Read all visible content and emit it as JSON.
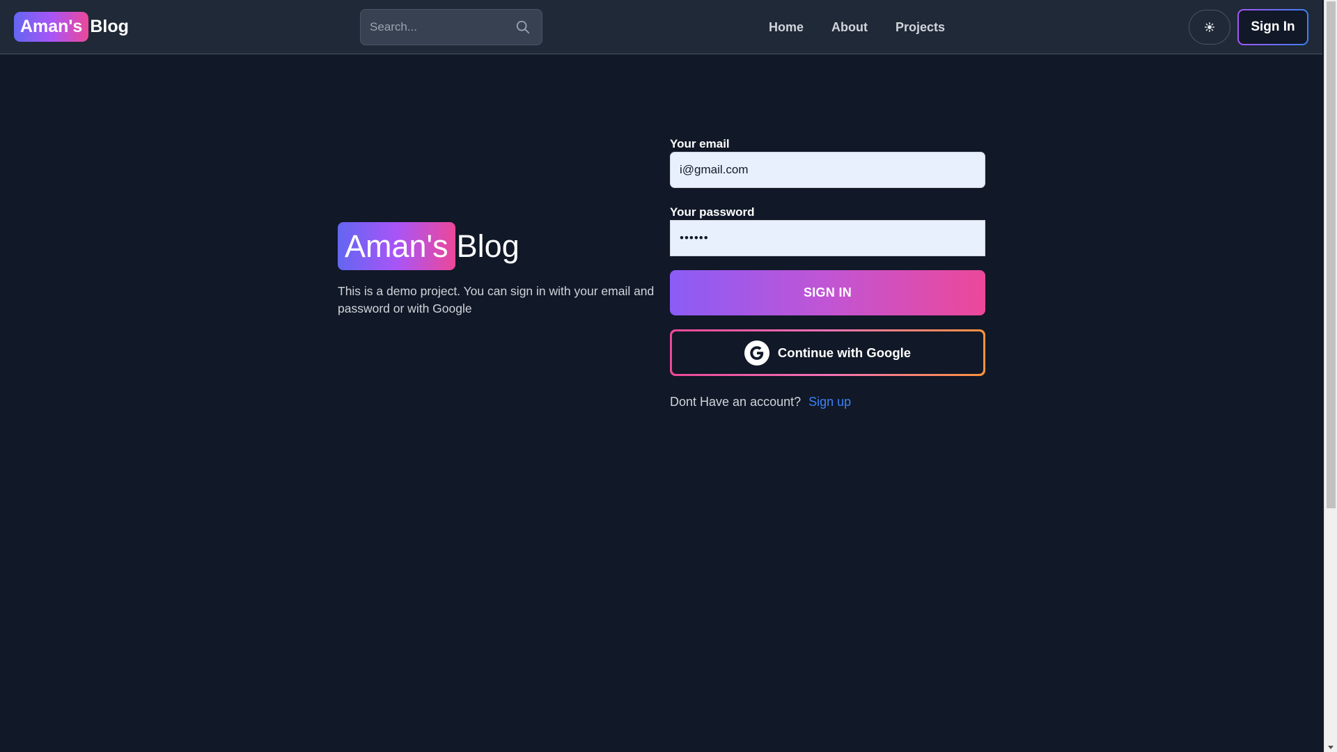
{
  "header": {
    "brand_highlight": "Aman's",
    "brand_rest": "Blog",
    "search_placeholder": "Search...",
    "search_value": "",
    "nav": [
      {
        "label": "Home"
      },
      {
        "label": "About"
      },
      {
        "label": "Projects"
      }
    ],
    "theme_toggle_icon": "sun-icon",
    "signin_label": "Sign In"
  },
  "hero": {
    "brand_highlight": "Aman's",
    "brand_rest": "Blog",
    "description": "This is a demo project. You can sign in with your email and password or with Google"
  },
  "form": {
    "email_label": "Your email",
    "email_value": "i@gmail.com",
    "password_label": "Your password",
    "password_value": "••••••",
    "signin_button": "SIGN IN",
    "google_button": "Continue with Google",
    "signup_prompt": "Dont Have an account?",
    "signup_link": "Sign up"
  },
  "colors": {
    "background": "#111827",
    "header_bg": "#1f2937",
    "gradient_start": "#6366f1",
    "gradient_mid": "#a855f7",
    "gradient_end": "#ec4899",
    "link": "#3b82f6"
  }
}
